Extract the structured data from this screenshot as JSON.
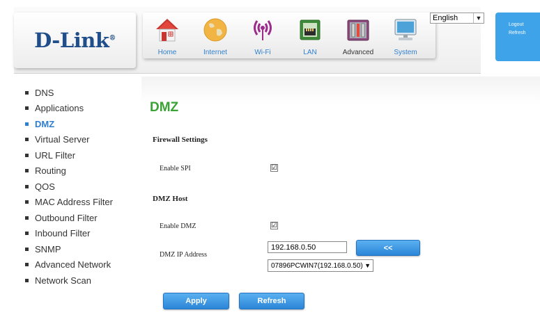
{
  "brand": {
    "name": "D-Link",
    "mark": "®"
  },
  "nav": [
    {
      "label": "Home",
      "icon": "home-icon"
    },
    {
      "label": "Internet",
      "icon": "globe-icon"
    },
    {
      "label": "Wi-Fi",
      "icon": "wifi-icon"
    },
    {
      "label": "LAN",
      "icon": "lan-icon"
    },
    {
      "label": "Advanced",
      "icon": "advanced-tools-icon"
    },
    {
      "label": "System",
      "icon": "computer-icon"
    }
  ],
  "language": {
    "value": "English"
  },
  "account": {
    "logout": "Logout",
    "refresh": "Refresh"
  },
  "sidebar": [
    {
      "label": "DNS"
    },
    {
      "label": "Applications"
    },
    {
      "label": "DMZ"
    },
    {
      "label": "Virtual Server"
    },
    {
      "label": "URL Filter"
    },
    {
      "label": "Routing"
    },
    {
      "label": "QOS"
    },
    {
      "label": "MAC Address Filter"
    },
    {
      "label": "Outbound Filter"
    },
    {
      "label": "Inbound Filter"
    },
    {
      "label": "SNMP"
    },
    {
      "label": "Advanced Network"
    },
    {
      "label": "Network Scan"
    }
  ],
  "page": {
    "title": "DMZ",
    "firewall_heading": "Firewall Settings",
    "enable_spi_label": "Enable SPI",
    "enable_spi_checked": "☑",
    "dmz_host_heading": "DMZ Host",
    "enable_dmz_label": "Enable DMZ",
    "enable_dmz_checked": "☑",
    "dmz_ip_label": "DMZ IP Address",
    "dmz_ip_value": "192.168.0.50",
    "copy_button": "<<",
    "host_select_value": "07896PCWIN7(192.168.0.50)",
    "apply_button": "Apply",
    "refresh_button": "Refresh"
  },
  "colors": {
    "brand_blue": "#1f4e8a",
    "accent_blue": "#2f7fd0",
    "title_green": "#3aa336"
  }
}
